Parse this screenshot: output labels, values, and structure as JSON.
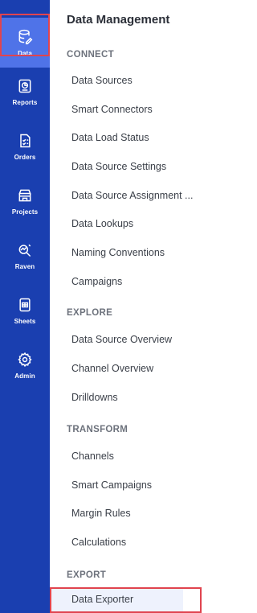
{
  "rail": [
    {
      "label": "Data",
      "icon": "database-icon"
    },
    {
      "label": "Reports",
      "icon": "reports-icon"
    },
    {
      "label": "Orders",
      "icon": "orders-icon"
    },
    {
      "label": "Projects",
      "icon": "projects-icon"
    },
    {
      "label": "Raven",
      "icon": "raven-icon"
    },
    {
      "label": "Sheets",
      "icon": "sheets-icon"
    },
    {
      "label": "Admin",
      "icon": "gear-icon"
    }
  ],
  "panel": {
    "title": "Data Management",
    "sections": {
      "connect": {
        "title": "CONNECT",
        "items": [
          "Data Sources",
          "Smart Connectors",
          "Data Load Status",
          "Data Source Settings",
          "Data Source Assignment ...",
          "Data Lookups",
          "Naming Conventions",
          "Campaigns"
        ]
      },
      "explore": {
        "title": "EXPLORE",
        "items": [
          "Data Source Overview",
          "Channel Overview",
          "Drilldowns"
        ]
      },
      "transform": {
        "title": "TRANSFORM",
        "items": [
          "Channels",
          "Smart Campaigns",
          "Margin Rules",
          "Calculations"
        ]
      },
      "export": {
        "title": "EXPORT",
        "items": [
          "Data Exporter"
        ]
      }
    }
  },
  "colors": {
    "rail_background": "#1a3fb0",
    "rail_active": "#4f73e8",
    "highlight_border": "#e0444f"
  }
}
